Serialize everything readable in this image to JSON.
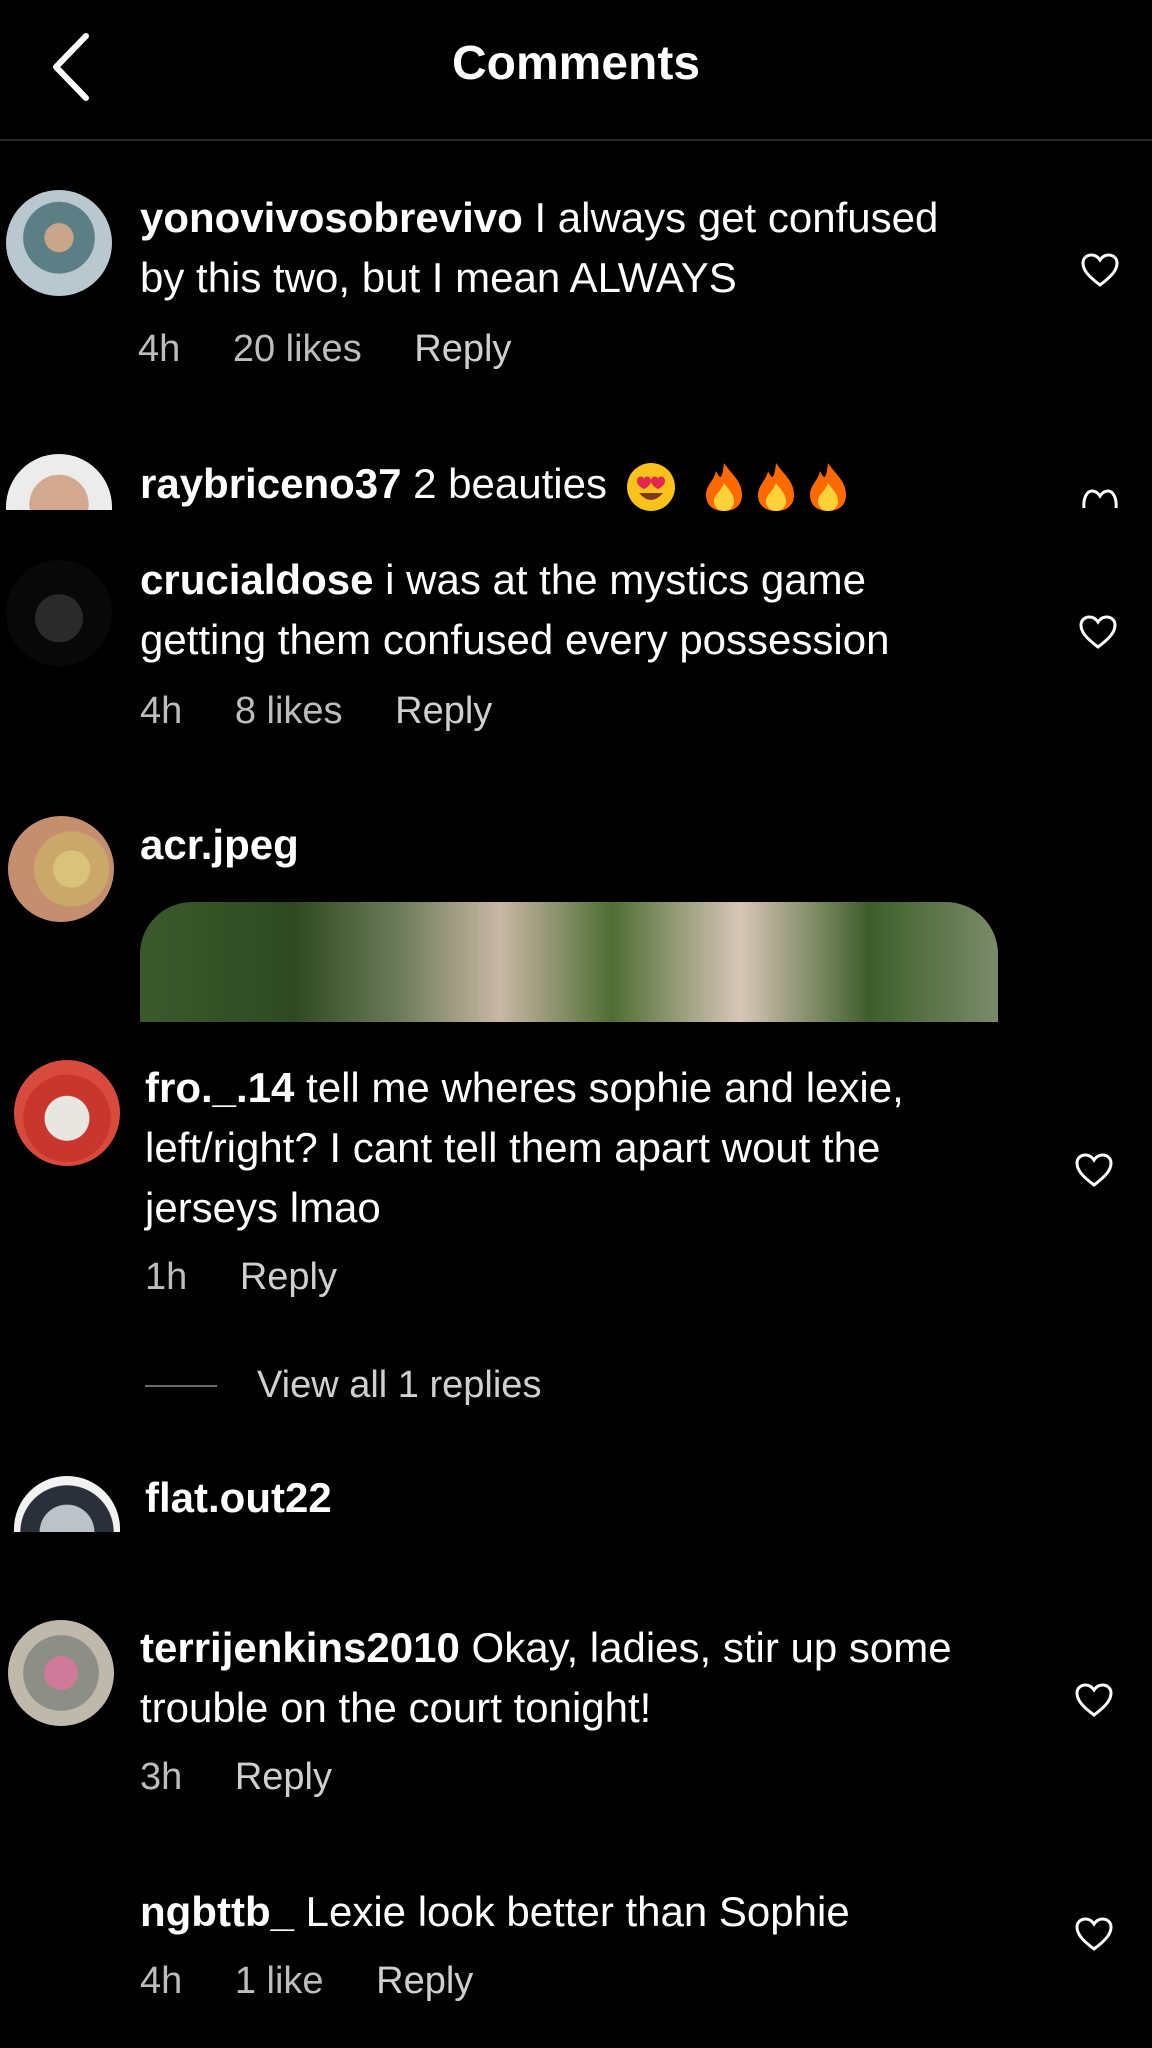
{
  "header": {
    "title": "Comments"
  },
  "comments": [
    {
      "user": "yonovivosobrevivo",
      "text1": "I always get confused",
      "text2": "by this two, but I mean ALWAYS",
      "time": "4h",
      "likes": "20 likes",
      "reply": "Reply"
    },
    {
      "user": "raybriceno37",
      "text": "2 beauties"
    },
    {
      "user": "crucialdose",
      "text1": "i was at the mystics game",
      "text2": "getting them confused every possession",
      "time": "4h",
      "likes": "8 likes",
      "reply": "Reply"
    },
    {
      "user": "acr.jpeg"
    },
    {
      "user": "fro._.14",
      "text1": "tell me wheres sophie and lexie,",
      "text2": "left/right? I cant tell them apart wout the",
      "text3": "jerseys lmao",
      "time": "1h",
      "reply": "Reply",
      "view_replies": "View all 1 replies"
    },
    {
      "user": "flat.out22"
    },
    {
      "user": "terrijenkins2010",
      "text1": "Okay, ladies, stir up some",
      "text2": "trouble on the court tonight!",
      "time": "3h",
      "reply": "Reply"
    },
    {
      "user": "ngbttb_",
      "text": "Lexie look better than Sophie",
      "time": "4h",
      "likes": "1 like",
      "reply": "Reply"
    }
  ],
  "colors": {
    "background": "#000000",
    "text": "#ffffff",
    "meta": "#bdbdbd",
    "divider": "#2a2a2a"
  },
  "icons": [
    "back-arrow-icon",
    "heart-icon",
    "heart-eyes-emoji",
    "fire-emoji"
  ]
}
